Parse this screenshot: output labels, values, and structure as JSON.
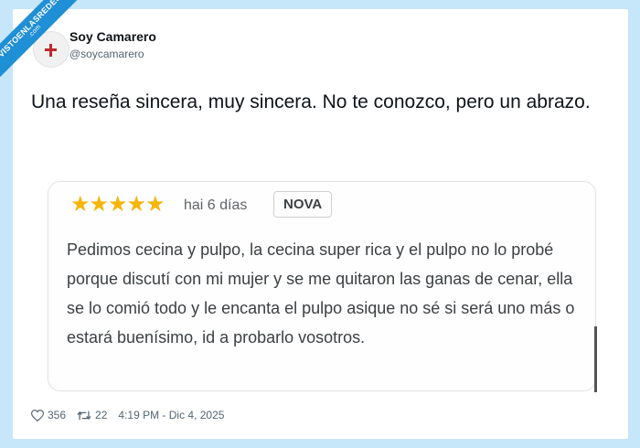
{
  "watermark": {
    "line1": "VISTOENLASREDES",
    "line2": ".com"
  },
  "author": {
    "name": "Soy Camarero",
    "handle": "@soycamarero",
    "avatar_icon": "red-cross-logo-icon"
  },
  "tweet": {
    "text": "Una reseña sincera, muy sincera. No te conozco, pero un abrazo."
  },
  "review": {
    "stars": "★★★★★",
    "rating": 5,
    "time_ago": "hai 6 días",
    "badge": "NOVA",
    "body": "Pedimos cecina y pulpo, la cecina super rica y el pulpo no lo probé porque discutí con mi mujer y se me quitaron las ganas de cenar, ella se lo comió todo y le encanta el pulpo asique no sé si será uno más o estará buenísimo, id a probarlo vosotros."
  },
  "footer": {
    "likes": "356",
    "retweets": "22",
    "timestamp": "4:19 PM - Dic 4, 2025"
  },
  "colors": {
    "background": "#c6e6f9",
    "ribbon": "#1f8fd6",
    "stars": "#f5b50a"
  }
}
